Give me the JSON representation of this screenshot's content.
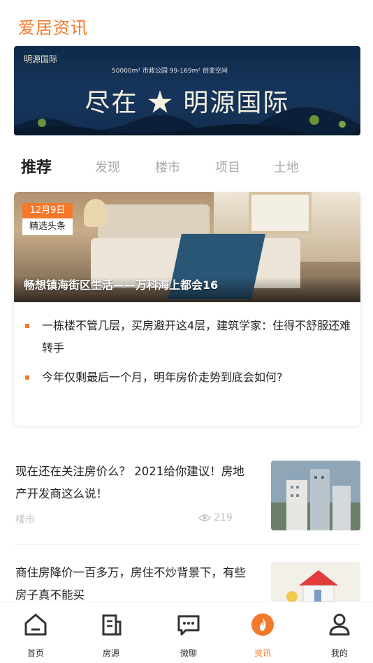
{
  "header": {
    "title": "爱居资讯"
  },
  "banner": {
    "logo": "明源国际",
    "spec": "50000m² 市政公园  99-169m² 创变空间",
    "slogan": "尽在 ★ 明源国际"
  },
  "tabs": [
    {
      "label": "推荐",
      "active": true
    },
    {
      "label": "发现",
      "active": false
    },
    {
      "label": "楼市",
      "active": false
    },
    {
      "label": "项目",
      "active": false
    },
    {
      "label": "土地",
      "active": false
    }
  ],
  "featured": {
    "date": "12月9日",
    "category": "精选头条",
    "title": "畅想镇海街区生活——万科海上都会16",
    "bullets": [
      "一栋楼不管几层，买房避开这4层，建筑学家：住得不舒服还难转手",
      "今年仅剩最后一个月，明年房价走势到底会如何?"
    ]
  },
  "articles": [
    {
      "title": "现在还在关注房价么？ 2021给你建议！房地产开发商这么说！",
      "category": "楼市",
      "views": "219"
    },
    {
      "title": "商住房降价一百多万，房住不炒背景下，有些房子真不能买"
    }
  ],
  "bottom_nav": [
    {
      "label": "首页",
      "icon": "home-icon",
      "active": false
    },
    {
      "label": "房源",
      "icon": "building-icon",
      "active": false
    },
    {
      "label": "微聊",
      "icon": "chat-icon",
      "active": false
    },
    {
      "label": "资讯",
      "icon": "news-icon",
      "active": true
    },
    {
      "label": "我的",
      "icon": "user-icon",
      "active": false
    }
  ],
  "colors": {
    "accent": "#f5792a",
    "muted": "#c2c2c2",
    "text": "#222222"
  }
}
